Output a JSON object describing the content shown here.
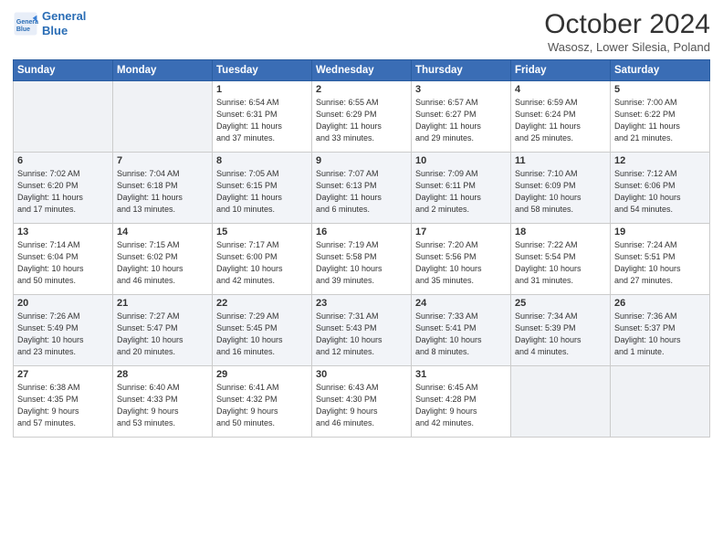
{
  "header": {
    "logo_line1": "General",
    "logo_line2": "Blue",
    "month": "October 2024",
    "location": "Wasosz, Lower Silesia, Poland"
  },
  "weekdays": [
    "Sunday",
    "Monday",
    "Tuesday",
    "Wednesday",
    "Thursday",
    "Friday",
    "Saturday"
  ],
  "weeks": [
    [
      {
        "day": "",
        "info": ""
      },
      {
        "day": "",
        "info": ""
      },
      {
        "day": "1",
        "info": "Sunrise: 6:54 AM\nSunset: 6:31 PM\nDaylight: 11 hours\nand 37 minutes."
      },
      {
        "day": "2",
        "info": "Sunrise: 6:55 AM\nSunset: 6:29 PM\nDaylight: 11 hours\nand 33 minutes."
      },
      {
        "day": "3",
        "info": "Sunrise: 6:57 AM\nSunset: 6:27 PM\nDaylight: 11 hours\nand 29 minutes."
      },
      {
        "day": "4",
        "info": "Sunrise: 6:59 AM\nSunset: 6:24 PM\nDaylight: 11 hours\nand 25 minutes."
      },
      {
        "day": "5",
        "info": "Sunrise: 7:00 AM\nSunset: 6:22 PM\nDaylight: 11 hours\nand 21 minutes."
      }
    ],
    [
      {
        "day": "6",
        "info": "Sunrise: 7:02 AM\nSunset: 6:20 PM\nDaylight: 11 hours\nand 17 minutes."
      },
      {
        "day": "7",
        "info": "Sunrise: 7:04 AM\nSunset: 6:18 PM\nDaylight: 11 hours\nand 13 minutes."
      },
      {
        "day": "8",
        "info": "Sunrise: 7:05 AM\nSunset: 6:15 PM\nDaylight: 11 hours\nand 10 minutes."
      },
      {
        "day": "9",
        "info": "Sunrise: 7:07 AM\nSunset: 6:13 PM\nDaylight: 11 hours\nand 6 minutes."
      },
      {
        "day": "10",
        "info": "Sunrise: 7:09 AM\nSunset: 6:11 PM\nDaylight: 11 hours\nand 2 minutes."
      },
      {
        "day": "11",
        "info": "Sunrise: 7:10 AM\nSunset: 6:09 PM\nDaylight: 10 hours\nand 58 minutes."
      },
      {
        "day": "12",
        "info": "Sunrise: 7:12 AM\nSunset: 6:06 PM\nDaylight: 10 hours\nand 54 minutes."
      }
    ],
    [
      {
        "day": "13",
        "info": "Sunrise: 7:14 AM\nSunset: 6:04 PM\nDaylight: 10 hours\nand 50 minutes."
      },
      {
        "day": "14",
        "info": "Sunrise: 7:15 AM\nSunset: 6:02 PM\nDaylight: 10 hours\nand 46 minutes."
      },
      {
        "day": "15",
        "info": "Sunrise: 7:17 AM\nSunset: 6:00 PM\nDaylight: 10 hours\nand 42 minutes."
      },
      {
        "day": "16",
        "info": "Sunrise: 7:19 AM\nSunset: 5:58 PM\nDaylight: 10 hours\nand 39 minutes."
      },
      {
        "day": "17",
        "info": "Sunrise: 7:20 AM\nSunset: 5:56 PM\nDaylight: 10 hours\nand 35 minutes."
      },
      {
        "day": "18",
        "info": "Sunrise: 7:22 AM\nSunset: 5:54 PM\nDaylight: 10 hours\nand 31 minutes."
      },
      {
        "day": "19",
        "info": "Sunrise: 7:24 AM\nSunset: 5:51 PM\nDaylight: 10 hours\nand 27 minutes."
      }
    ],
    [
      {
        "day": "20",
        "info": "Sunrise: 7:26 AM\nSunset: 5:49 PM\nDaylight: 10 hours\nand 23 minutes."
      },
      {
        "day": "21",
        "info": "Sunrise: 7:27 AM\nSunset: 5:47 PM\nDaylight: 10 hours\nand 20 minutes."
      },
      {
        "day": "22",
        "info": "Sunrise: 7:29 AM\nSunset: 5:45 PM\nDaylight: 10 hours\nand 16 minutes."
      },
      {
        "day": "23",
        "info": "Sunrise: 7:31 AM\nSunset: 5:43 PM\nDaylight: 10 hours\nand 12 minutes."
      },
      {
        "day": "24",
        "info": "Sunrise: 7:33 AM\nSunset: 5:41 PM\nDaylight: 10 hours\nand 8 minutes."
      },
      {
        "day": "25",
        "info": "Sunrise: 7:34 AM\nSunset: 5:39 PM\nDaylight: 10 hours\nand 4 minutes."
      },
      {
        "day": "26",
        "info": "Sunrise: 7:36 AM\nSunset: 5:37 PM\nDaylight: 10 hours\nand 1 minute."
      }
    ],
    [
      {
        "day": "27",
        "info": "Sunrise: 6:38 AM\nSunset: 4:35 PM\nDaylight: 9 hours\nand 57 minutes."
      },
      {
        "day": "28",
        "info": "Sunrise: 6:40 AM\nSunset: 4:33 PM\nDaylight: 9 hours\nand 53 minutes."
      },
      {
        "day": "29",
        "info": "Sunrise: 6:41 AM\nSunset: 4:32 PM\nDaylight: 9 hours\nand 50 minutes."
      },
      {
        "day": "30",
        "info": "Sunrise: 6:43 AM\nSunset: 4:30 PM\nDaylight: 9 hours\nand 46 minutes."
      },
      {
        "day": "31",
        "info": "Sunrise: 6:45 AM\nSunset: 4:28 PM\nDaylight: 9 hours\nand 42 minutes."
      },
      {
        "day": "",
        "info": ""
      },
      {
        "day": "",
        "info": ""
      }
    ]
  ]
}
